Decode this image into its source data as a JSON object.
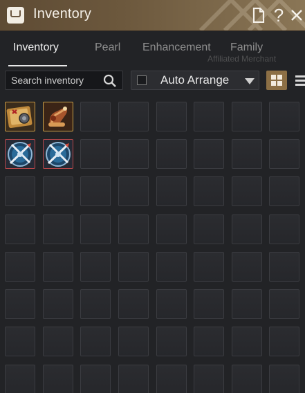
{
  "window": {
    "title": "Inventory",
    "buttons": {
      "page_icon": "document-icon",
      "help_label": "?",
      "close_icon": "close-icon"
    }
  },
  "tabs": [
    {
      "label": "Inventory",
      "active": true
    },
    {
      "label": "Pearl",
      "active": false
    },
    {
      "label": "Enhancement",
      "active": false
    },
    {
      "label": "Family",
      "active": false
    }
  ],
  "background_text": "Affiliated Merchant",
  "search": {
    "placeholder": "Search inventory",
    "value": ""
  },
  "arrange": {
    "label": "Auto Arrange",
    "checked": false
  },
  "view_modes": {
    "grid": "grid-view-icon",
    "list": "list-view-icon",
    "selected": "grid"
  },
  "grid": {
    "columns": 8,
    "visible_rows": 8,
    "items": [
      {
        "row": 0,
        "col": 0,
        "icon": "treasure-map-item-icon",
        "border": "gold"
      },
      {
        "row": 0,
        "col": 1,
        "icon": "rolled-scroll-item-icon",
        "border": "gold"
      },
      {
        "row": 1,
        "col": 0,
        "icon": "blue-orb-crossed-blades-item-icon",
        "border": "red"
      },
      {
        "row": 1,
        "col": 1,
        "icon": "blue-orb-crossed-blades-item-icon",
        "border": "red"
      }
    ]
  },
  "colors": {
    "title_bar": "#6c583d",
    "accent": "#8c6f45",
    "gold_border": "#c99a45",
    "red_border": "#b8484a"
  }
}
